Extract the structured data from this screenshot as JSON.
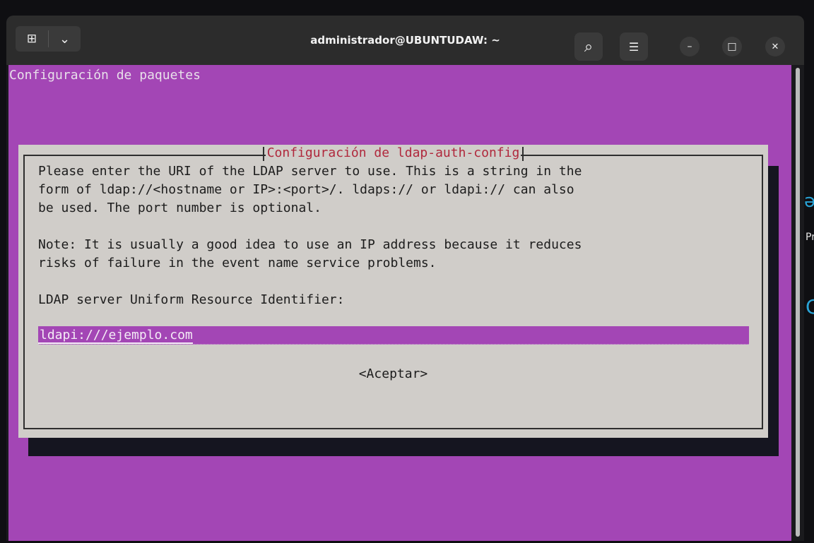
{
  "window": {
    "title": "administrador@UBUNTUDAW: ~"
  },
  "titlebar": {
    "new_tab_icon": "⊞",
    "dropdown_icon": "⌄",
    "search_icon": "⌕",
    "menu_icon": "☰",
    "minimize_icon": "–",
    "maximize_icon": "□",
    "close_icon": "✕"
  },
  "terminal": {
    "header": "Configuración de paquetes",
    "dialog": {
      "title": "Configuración de ldap-auth-config",
      "lines": [
        "Please enter the URI of the LDAP server to use. This is a string in the",
        "form of ldap://<hostname or IP>:<port>/. ldaps:// or ldapi:// can also",
        "be used. The port number is optional.",
        "",
        "Note: It is usually a good idea to use an IP address because it reduces",
        "risks of failure in the event name service problems.",
        "",
        "LDAP server Uniform Resource Identifier:"
      ],
      "input_value": "ldapi:///ejemplo.com",
      "ok_button": "<Aceptar>"
    },
    "background_color": "#a346b5"
  },
  "background_fragments": {
    "frag1": "ə",
    "frag2": "Pr",
    "frag3": "C"
  }
}
